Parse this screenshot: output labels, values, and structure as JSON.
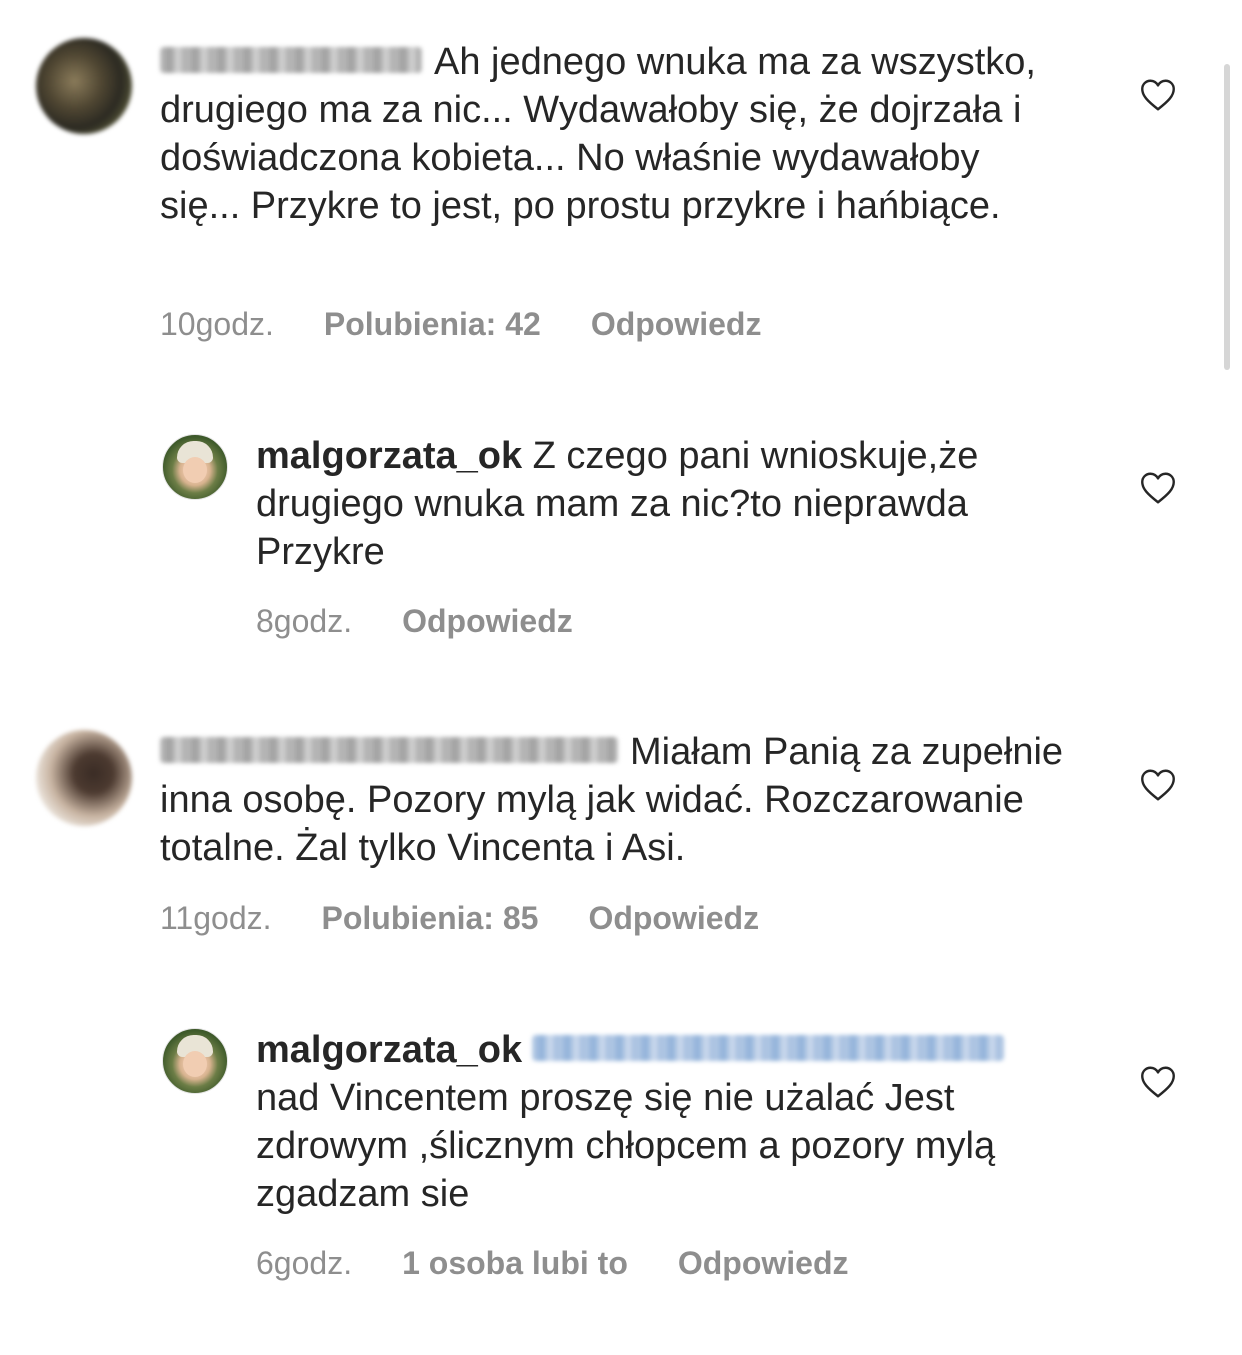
{
  "comments": [
    {
      "username_blurred": true,
      "text_lead": "Ah jednego wnuka ma za",
      "text_rest": "wszystko, drugiego ma za nic... Wydawałoby się, że dojrzała i doświadczona kobieta... No właśnie wydawałoby się... Przykre to jest, po prostu przykre i hańbiące.",
      "time": "10godz.",
      "likes": "Polubienia: 42",
      "reply": "Odpowiedz",
      "icon": "heart-outline-icon"
    },
    {
      "username": "malgorzata_ok",
      "text": "Z czego pani wnioskuje,że drugiego wnuka mam za nic?to nieprawda Przykre",
      "time": "8godz.",
      "reply": "Odpowiedz",
      "icon": "heart-outline-icon"
    },
    {
      "username_blurred": true,
      "text_lead": "Miałam Panią za",
      "text_rest": "zupełnie inna osobę. Pozory mylą jak widać. Rozczarowanie totalne. Żal tylko Vincenta i Asi.",
      "time": "11godz.",
      "likes": "Polubienia: 85",
      "reply": "Odpowiedz",
      "icon": "heart-outline-icon"
    },
    {
      "username": "malgorzata_ok",
      "mention_blurred": true,
      "text": "nad Vincentem proszę się nie użalać Jest zdrowym ,ślicznym chłopcem a pozory mylą zgadzam sie",
      "time": "6godz.",
      "likes": "1 osoba lubi to",
      "reply": "Odpowiedz",
      "icon": "heart-outline-icon"
    }
  ],
  "colors": {
    "text": "#262626",
    "meta": "#8e8e8e",
    "background": "#ffffff"
  }
}
